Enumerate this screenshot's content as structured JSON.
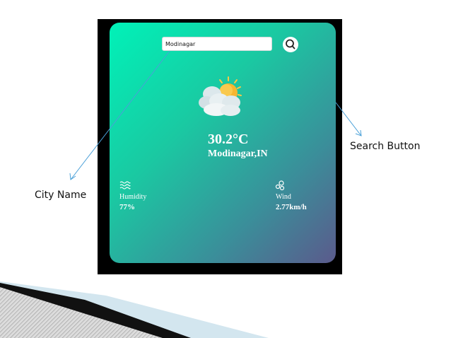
{
  "app": {
    "search": {
      "value": "Modinagar"
    },
    "temperature": "30.2°C",
    "location": "Modinagar,IN",
    "humidity": {
      "label": "Humidity",
      "value": "77%"
    },
    "wind": {
      "label": "Wind",
      "value": "2.77km/h"
    }
  },
  "callouts": {
    "city_name": "City Name",
    "search_button": "Search Button"
  },
  "icons": {
    "search": "search-icon",
    "weather": "sun-behind-clouds-icon",
    "humidity": "humidity-waves-icon",
    "wind": "wind-icon"
  },
  "colors": {
    "card_gradient_start": "#00f2b8",
    "card_gradient_end": "#5b5a8c",
    "frame": "#000000",
    "annotation_line": "#4aa0d8"
  }
}
